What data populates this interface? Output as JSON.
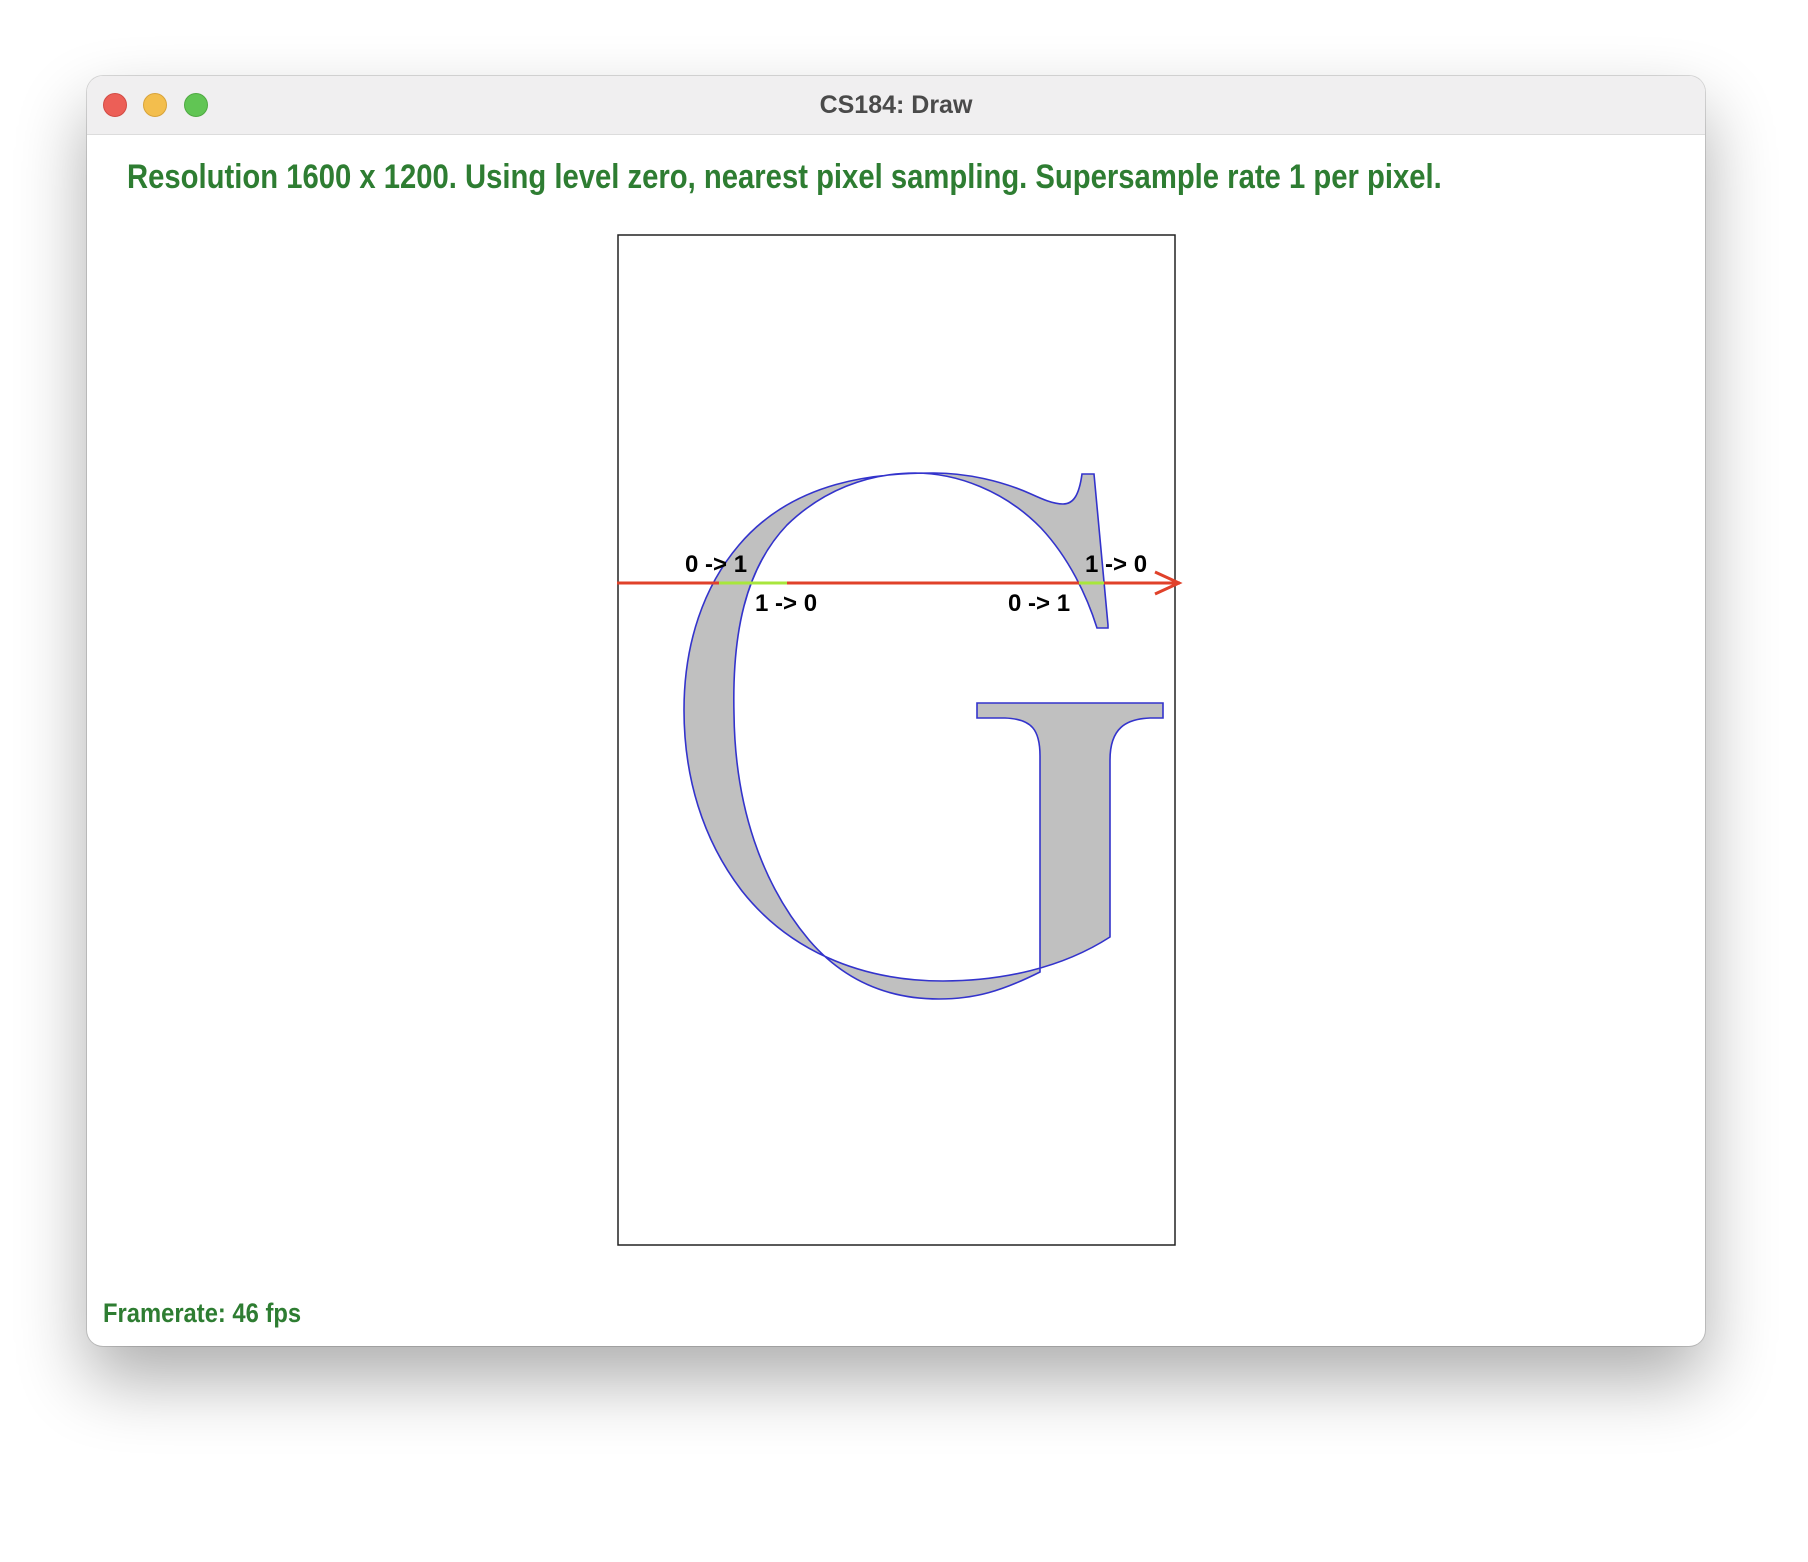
{
  "window": {
    "title": "CS184: Draw"
  },
  "status_text": "Resolution 1600 x 1200. Using level zero, nearest pixel sampling. Supersample rate 1 per pixel.",
  "framerate_text": "Framerate: 46 fps",
  "glyph": {
    "letter": "G",
    "fill_color": "#c0c0c0",
    "outline_color": "#3333cc"
  },
  "scanline": {
    "color": "#e0412a",
    "inside_color": "#a8e63c"
  },
  "crossings": [
    {
      "label": "0 -> 1"
    },
    {
      "label": "1 -> 0"
    },
    {
      "label": "0 -> 1"
    },
    {
      "label": "1 -> 0"
    }
  ],
  "colors": {
    "status_text": "#2e7d32",
    "close": "#ec5f57",
    "minimize": "#f3be4d",
    "maximize": "#61c554"
  }
}
